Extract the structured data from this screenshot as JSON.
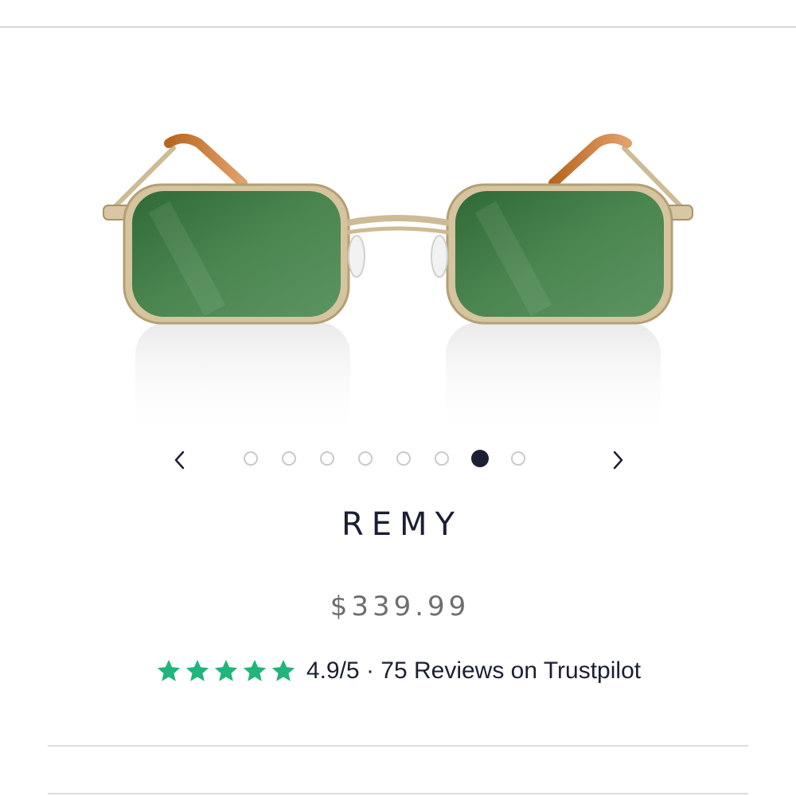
{
  "product": {
    "name": "REMY",
    "price": "$339.99",
    "image_alt": "Remy gold metal frame sunglasses with green lenses"
  },
  "carousel": {
    "total_images": 8,
    "active_index": 6,
    "prev_icon": "chevron-left-icon",
    "next_icon": "chevron-right-icon"
  },
  "rating": {
    "stars": 5,
    "text": "4.9/5 · 75 Reviews on Trustpilot",
    "star_color": "#20b57a"
  },
  "colors": {
    "text_dark": "#1b1f33",
    "price_gray": "#6e6e6e",
    "lens_green": "#3f7a45",
    "frame_gold": "#c9b48c"
  }
}
